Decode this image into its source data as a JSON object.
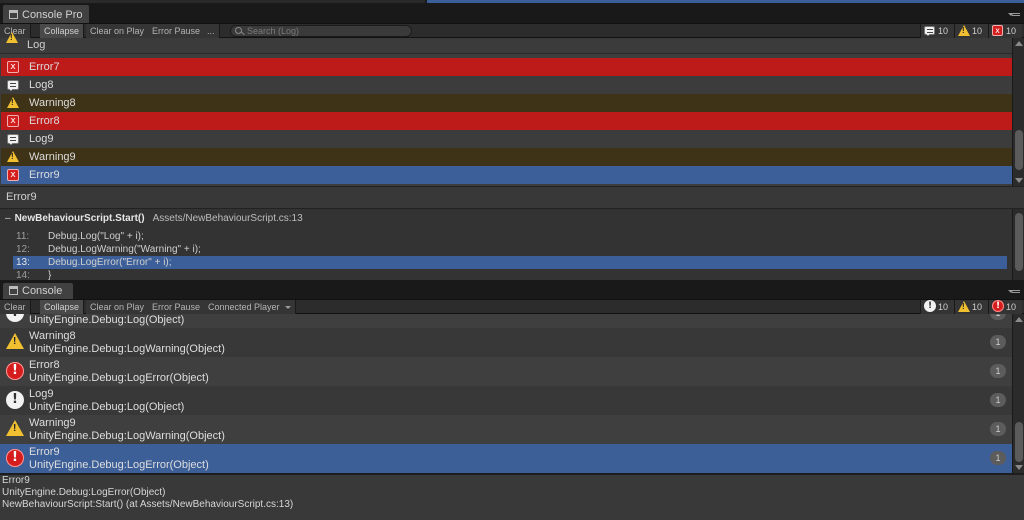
{
  "pro": {
    "tab_label": "Console Pro",
    "toolbar": {
      "clear": "Clear",
      "collapse": "Collapse",
      "clear_on_play": "Clear on Play",
      "error_pause": "Error Pause",
      "more": "...",
      "search_placeholder": "Search (Log)",
      "log_count": "10",
      "warn_count": "10",
      "error_count": "10"
    },
    "filter_header": "Log",
    "rows": [
      {
        "type": "error",
        "text": "Error7"
      },
      {
        "type": "log",
        "text": "Log8"
      },
      {
        "type": "warning",
        "text": "Warning8"
      },
      {
        "type": "error",
        "text": "Error8"
      },
      {
        "type": "log",
        "text": "Log9"
      },
      {
        "type": "warning",
        "text": "Warning9"
      },
      {
        "type": "error-selected",
        "text": "Error9"
      }
    ],
    "selected_message": "Error9",
    "stack": {
      "collapse_symbol": "–",
      "method": "NewBehaviourScript.Start()",
      "location": "Assets/NewBehaviourScript.cs:13",
      "lines": [
        {
          "num": "11:",
          "code": "Debug.Log(\"Log\" + i);"
        },
        {
          "num": "12:",
          "code": "Debug.LogWarning(\"Warning\" + i);"
        },
        {
          "num": "13:",
          "code": "Debug.LogError(\"Error\" + i);"
        },
        {
          "num": "14:",
          "code": "}"
        }
      ]
    }
  },
  "console": {
    "tab_label": "Console",
    "toolbar": {
      "clear": "Clear",
      "collapse": "Collapse",
      "clear_on_play": "Clear on Play",
      "error_pause": "Error Pause",
      "connected_player": "Connected Player",
      "log_count": "10",
      "warn_count": "10",
      "error_count": "10"
    },
    "rows": [
      {
        "type": "log",
        "title": "",
        "sub": "UnityEngine.Debug:Log(Object)",
        "count": "1"
      },
      {
        "type": "warning",
        "title": "Warning8",
        "sub": "UnityEngine.Debug:LogWarning(Object)",
        "count": "1"
      },
      {
        "type": "error",
        "title": "Error8",
        "sub": "UnityEngine.Debug:LogError(Object)",
        "count": "1"
      },
      {
        "type": "log",
        "title": "Log9",
        "sub": "UnityEngine.Debug:Log(Object)",
        "count": "1"
      },
      {
        "type": "warning",
        "title": "Warning9",
        "sub": "UnityEngine.Debug:LogWarning(Object)",
        "count": "1"
      },
      {
        "type": "error",
        "title": "Error9",
        "sub": "UnityEngine.Debug:LogError(Object)",
        "count": "1"
      }
    ],
    "detail": [
      "Error9",
      "UnityEngine.Debug:LogError(Object)",
      "NewBehaviourScript:Start() (at Assets/NewBehaviourScript.cs:13)"
    ]
  },
  "colors": {
    "error_row": "#bd1a1a",
    "warning_row": "#3e3316",
    "selected_row": "#3c5f99"
  }
}
